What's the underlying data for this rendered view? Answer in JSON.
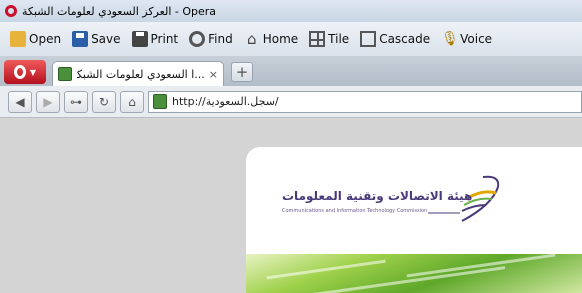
{
  "window": {
    "title": "العركز السعودي لعلومات الشبكة - Opera"
  },
  "toolbar": {
    "items": [
      {
        "label": "Open",
        "icon": "open-folder-icon"
      },
      {
        "label": "Save",
        "icon": "save-disk-icon"
      },
      {
        "label": "Print",
        "icon": "printer-icon"
      },
      {
        "label": "Find",
        "icon": "magnifier-icon"
      },
      {
        "label": "Home",
        "icon": "home-icon"
      },
      {
        "label": "Tile",
        "icon": "tile-icon"
      },
      {
        "label": "Cascade",
        "icon": "cascade-icon"
      },
      {
        "label": "Voice",
        "icon": "microphone-icon"
      }
    ]
  },
  "tabs": {
    "active_label": "...ا السعودي لعلومات الشبكة",
    "close_glyph": "×",
    "new_tab_glyph": "+"
  },
  "address": {
    "url": "http://سجل.السعودية/"
  },
  "page": {
    "logo_arabic": "هيئة الاتصالات وتقنية المعلومات",
    "logo_english": "Communications and Information Technology Commission"
  },
  "colors": {
    "opera_red": "#c8102e",
    "tab_bar": "#c0c8d2",
    "banner_green": "#8bc34a"
  }
}
